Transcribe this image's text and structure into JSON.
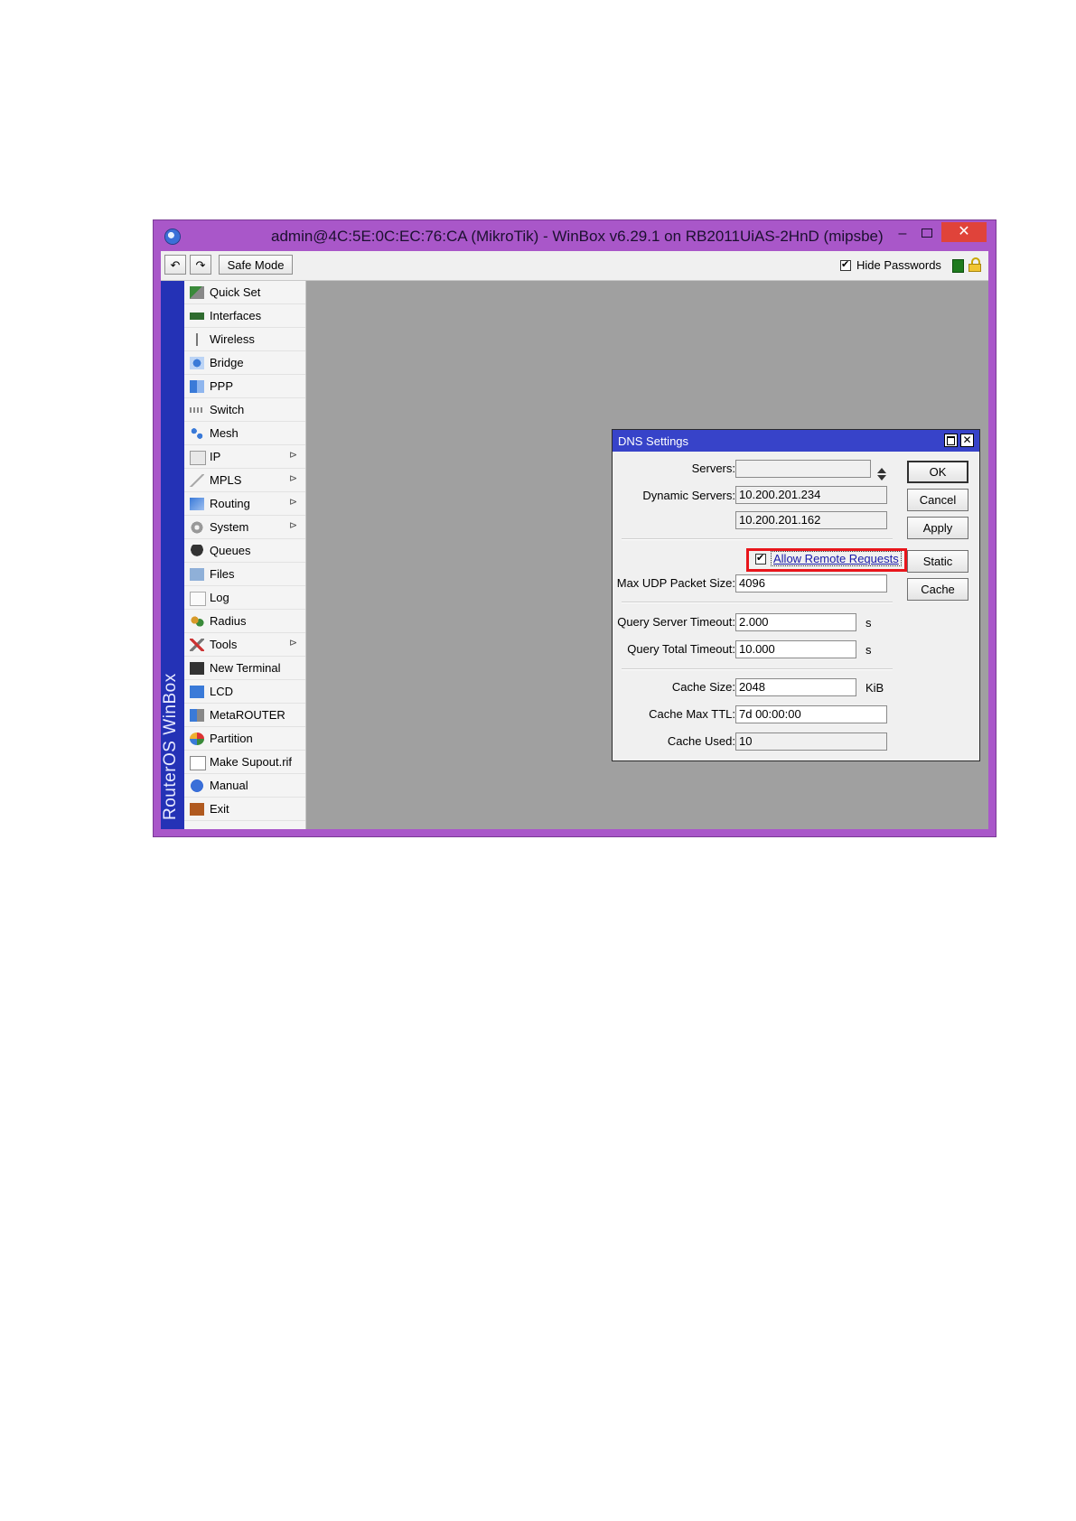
{
  "window": {
    "title": "admin@4C:5E:0C:EC:76:CA (MikroTik) - WinBox v6.29.1 on RB2011UiAS-2HnD (mipsbe)",
    "minimize_glyph": "–",
    "close_glyph": "✕",
    "accent_color": "#a957c9"
  },
  "toolbar": {
    "undo_glyph": "↶",
    "redo_glyph": "↷",
    "safe_mode_label": "Safe Mode",
    "hide_passwords_label": "Hide Passwords",
    "hide_passwords_checked": true
  },
  "sidebar": {
    "brand_text": "RouterOS WinBox",
    "items": [
      {
        "label": "Quick Set",
        "icon": "wand-icon",
        "submenu": false
      },
      {
        "label": "Interfaces",
        "icon": "interfaces-icon",
        "submenu": false
      },
      {
        "label": "Wireless",
        "icon": "antenna-icon",
        "submenu": false
      },
      {
        "label": "Bridge",
        "icon": "bridge-icon",
        "submenu": false
      },
      {
        "label": "PPP",
        "icon": "ppp-icon",
        "submenu": false
      },
      {
        "label": "Switch",
        "icon": "switch-icon",
        "submenu": false
      },
      {
        "label": "Mesh",
        "icon": "mesh-icon",
        "submenu": false
      },
      {
        "label": "IP",
        "icon": "ip-icon",
        "submenu": true
      },
      {
        "label": "MPLS",
        "icon": "mpls-icon",
        "submenu": true
      },
      {
        "label": "Routing",
        "icon": "routing-icon",
        "submenu": true
      },
      {
        "label": "System",
        "icon": "gear-icon",
        "submenu": true
      },
      {
        "label": "Queues",
        "icon": "queues-icon",
        "submenu": false
      },
      {
        "label": "Files",
        "icon": "folder-icon",
        "submenu": false
      },
      {
        "label": "Log",
        "icon": "log-icon",
        "submenu": false
      },
      {
        "label": "Radius",
        "icon": "radius-icon",
        "submenu": false
      },
      {
        "label": "Tools",
        "icon": "tools-icon",
        "submenu": true
      },
      {
        "label": "New Terminal",
        "icon": "terminal-icon",
        "submenu": false
      },
      {
        "label": "LCD",
        "icon": "lcd-icon",
        "submenu": false
      },
      {
        "label": "MetaROUTER",
        "icon": "metarouter-icon",
        "submenu": false
      },
      {
        "label": "Partition",
        "icon": "partition-icon",
        "submenu": false
      },
      {
        "label": "Make Supout.rif",
        "icon": "file-icon",
        "submenu": false
      },
      {
        "label": "Manual",
        "icon": "help-icon",
        "submenu": false
      },
      {
        "label": "Exit",
        "icon": "exit-icon",
        "submenu": false
      }
    ]
  },
  "dialog": {
    "title": "DNS Settings",
    "close_glyph": "✕",
    "servers_label": "Servers:",
    "servers_value": "",
    "dynamic_servers_label": "Dynamic Servers:",
    "dynamic_servers": [
      "10.200.201.234",
      "10.200.201.162"
    ],
    "allow_remote_label": "Allow Remote Requests",
    "allow_remote_checked": true,
    "max_udp_label": "Max UDP Packet Size:",
    "max_udp_value": "4096",
    "query_server_timeout_label": "Query Server Timeout:",
    "query_server_timeout_value": "2.000",
    "query_server_timeout_unit": "s",
    "query_total_timeout_label": "Query Total Timeout:",
    "query_total_timeout_value": "10.000",
    "query_total_timeout_unit": "s",
    "cache_size_label": "Cache Size:",
    "cache_size_value": "2048",
    "cache_size_unit": "KiB",
    "cache_max_ttl_label": "Cache Max TTL:",
    "cache_max_ttl_value": "7d 00:00:00",
    "cache_used_label": "Cache Used:",
    "cache_used_value": "10",
    "buttons": {
      "ok": "OK",
      "cancel": "Cancel",
      "apply": "Apply",
      "static": "Static",
      "cache": "Cache"
    },
    "highlight_color": "#e8151b"
  }
}
